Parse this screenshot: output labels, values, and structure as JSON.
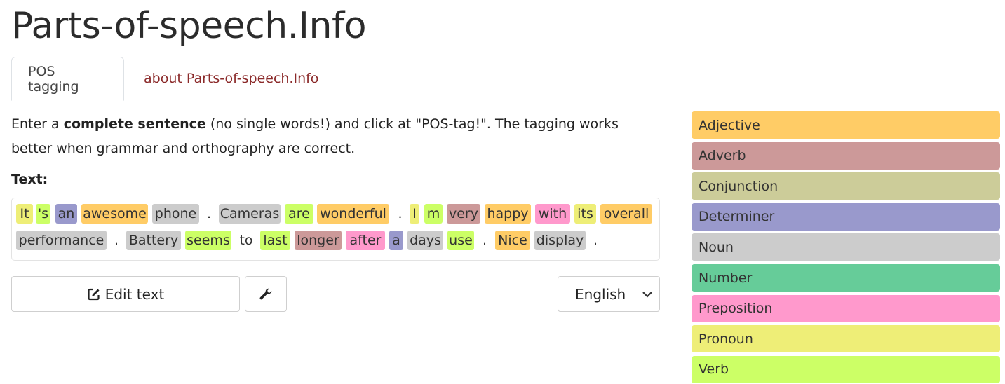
{
  "site": {
    "title": "Parts-of-speech.Info"
  },
  "tabs": [
    {
      "label": "POS tagging",
      "active": true
    },
    {
      "label": "about Parts-of-speech.Info",
      "active": false
    }
  ],
  "intro": {
    "part1": "Enter a ",
    "bold": "complete sentence",
    "part2": " (no single words!) and click at \"POS-tag!\". The tagging works better when grammar and orthography are correct."
  },
  "text_label": "Text:",
  "tagged_tokens": [
    {
      "text": "It",
      "pos": "pron"
    },
    {
      "text": "'s",
      "pos": "verb"
    },
    {
      "text": "an",
      "pos": "det"
    },
    {
      "text": "awesome",
      "pos": "adj"
    },
    {
      "text": "phone",
      "pos": "noun"
    },
    {
      "text": ".",
      "pos": "none"
    },
    {
      "text": "Cameras",
      "pos": "noun"
    },
    {
      "text": "are",
      "pos": "verb"
    },
    {
      "text": "wonderful",
      "pos": "adj"
    },
    {
      "text": ".",
      "pos": "none"
    },
    {
      "text": "I",
      "pos": "pron"
    },
    {
      "text": "m",
      "pos": "verb"
    },
    {
      "text": "very",
      "pos": "adv"
    },
    {
      "text": "happy",
      "pos": "adj"
    },
    {
      "text": "with",
      "pos": "prep"
    },
    {
      "text": "its",
      "pos": "pron"
    },
    {
      "text": "overall",
      "pos": "adj"
    },
    {
      "text": "performance",
      "pos": "noun"
    },
    {
      "text": ".",
      "pos": "none"
    },
    {
      "text": "Battery",
      "pos": "noun"
    },
    {
      "text": "seems",
      "pos": "verb"
    },
    {
      "text": "to",
      "pos": "none"
    },
    {
      "text": "last",
      "pos": "verb"
    },
    {
      "text": "longer",
      "pos": "adv"
    },
    {
      "text": "after",
      "pos": "prep"
    },
    {
      "text": "a",
      "pos": "det"
    },
    {
      "text": "days",
      "pos": "noun"
    },
    {
      "text": "use",
      "pos": "verb"
    },
    {
      "text": ".",
      "pos": "none"
    },
    {
      "text": "Nice",
      "pos": "adj"
    },
    {
      "text": "display",
      "pos": "noun"
    },
    {
      "text": ".",
      "pos": "none"
    }
  ],
  "buttons": {
    "edit_label": "Edit text",
    "edit_icon": "edit-icon",
    "tools_icon": "wrench-icon"
  },
  "language_select": {
    "selected": "English"
  },
  "legend": [
    {
      "label": "Adjective",
      "pos": "adj",
      "color": "#ffcc66"
    },
    {
      "label": "Adverb",
      "pos": "adv",
      "color": "#cc9999"
    },
    {
      "label": "Conjunction",
      "pos": "conj",
      "color": "#cccc99"
    },
    {
      "label": "Determiner",
      "pos": "det",
      "color": "#9999cc"
    },
    {
      "label": "Noun",
      "pos": "noun",
      "color": "#cccccc"
    },
    {
      "label": "Number",
      "pos": "num",
      "color": "#66cc99"
    },
    {
      "label": "Preposition",
      "pos": "prep",
      "color": "#ff99cc"
    },
    {
      "label": "Pronoun",
      "pos": "pron",
      "color": "#eeee77"
    },
    {
      "label": "Verb",
      "pos": "verb",
      "color": "#ccff66"
    }
  ]
}
